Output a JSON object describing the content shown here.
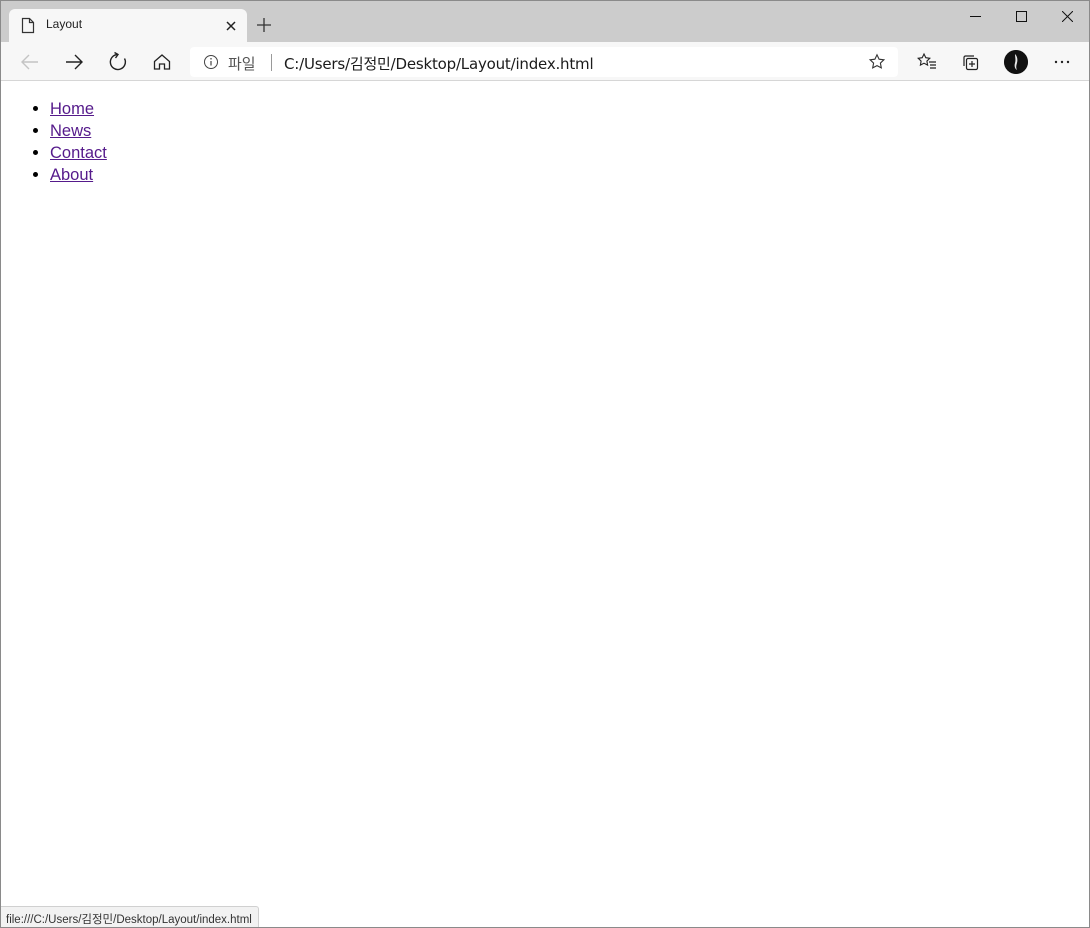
{
  "tab": {
    "title": "Layout"
  },
  "toolbar": {
    "scheme_label": "파일",
    "url": "C:/Users/김정민/Desktop/Layout/index.html"
  },
  "nav": {
    "items": [
      {
        "label": "Home"
      },
      {
        "label": "News"
      },
      {
        "label": "Contact"
      },
      {
        "label": "About"
      }
    ]
  },
  "status": {
    "url": "file:///C:/Users/김정민/Desktop/Layout/index.html"
  },
  "colors": {
    "tabstrip": "#cccccc",
    "toolbar": "#f7f7f7",
    "visited_link": "#551a8b"
  }
}
